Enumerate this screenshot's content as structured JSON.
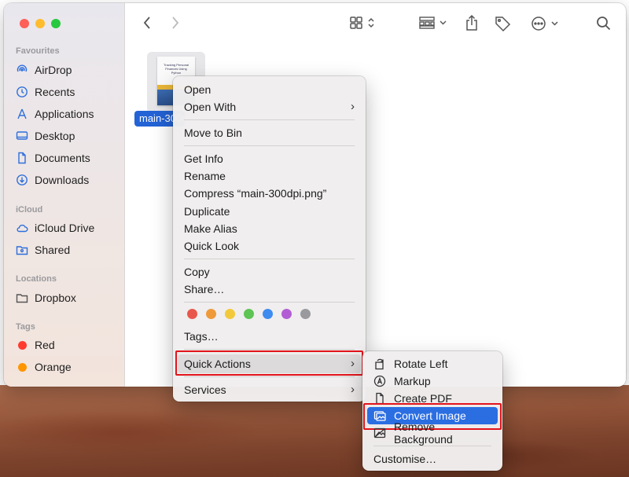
{
  "sidebar": {
    "favourites_header": "Favourites",
    "favourites": [
      {
        "label": "AirDrop",
        "icon": "airdrop-icon"
      },
      {
        "label": "Recents",
        "icon": "clock-icon"
      },
      {
        "label": "Applications",
        "icon": "applications-icon"
      },
      {
        "label": "Desktop",
        "icon": "desktop-icon"
      },
      {
        "label": "Documents",
        "icon": "document-icon"
      },
      {
        "label": "Downloads",
        "icon": "download-icon"
      }
    ],
    "icloud_header": "iCloud",
    "icloud": [
      {
        "label": "iCloud Drive",
        "icon": "cloud-icon"
      },
      {
        "label": "Shared",
        "icon": "shared-folder-icon"
      }
    ],
    "locations_header": "Locations",
    "locations": [
      {
        "label": "Dropbox",
        "icon": "folder-icon"
      }
    ],
    "tags_header": "Tags",
    "tags": [
      {
        "label": "Red",
        "color": "#ff3b30"
      },
      {
        "label": "Orange",
        "color": "#ff9500"
      }
    ]
  },
  "file": {
    "label": "main-300dpi.png",
    "thumb_title": "Tracking Personal Finances Using Python"
  },
  "context_menu": {
    "open": "Open",
    "open_with": "Open With",
    "move_to_bin": "Move to Bin",
    "get_info": "Get Info",
    "rename": "Rename",
    "compress": "Compress “main-300dpi.png”",
    "duplicate": "Duplicate",
    "make_alias": "Make Alias",
    "quick_look": "Quick Look",
    "copy": "Copy",
    "share": "Share…",
    "tag_colors": [
      "#e9574c",
      "#ee9a3a",
      "#f2c93a",
      "#5ec454",
      "#3e8cf0",
      "#b35dd4",
      "#9a9a9e"
    ],
    "tags": "Tags…",
    "quick_actions": "Quick Actions",
    "services": "Services"
  },
  "submenu": {
    "rotate_left": "Rotate Left",
    "markup": "Markup",
    "create_pdf": "Create PDF",
    "convert_image": "Convert Image",
    "remove_background": "Remove Background",
    "customise": "Customise…"
  },
  "colors": {
    "selection": "#2b6ee2",
    "highlight_box": "#e3131b"
  }
}
